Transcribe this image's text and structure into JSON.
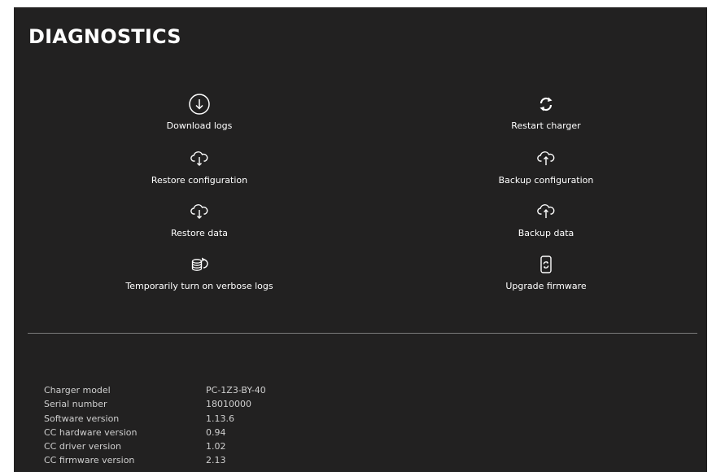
{
  "page": {
    "title": "DIAGNOSTICS"
  },
  "actions": {
    "download_logs": {
      "label": "Download logs",
      "icon": "download-circle-icon"
    },
    "restart_charger": {
      "label": "Restart charger",
      "icon": "refresh-icon"
    },
    "restore_configuration": {
      "label": "Restore configuration",
      "icon": "cloud-download-icon"
    },
    "backup_configuration": {
      "label": "Backup configuration",
      "icon": "cloud-upload-icon"
    },
    "restore_data": {
      "label": "Restore data",
      "icon": "cloud-download-icon"
    },
    "backup_data": {
      "label": "Backup data",
      "icon": "cloud-upload-icon"
    },
    "verbose_logs": {
      "label": "Temporarily turn on verbose logs",
      "icon": "database-refresh-icon"
    },
    "upgrade_firmware": {
      "label": "Upgrade firmware",
      "icon": "device-refresh-icon"
    }
  },
  "info": [
    {
      "key": "Charger model",
      "value": "PC-1Z3-BY-40"
    },
    {
      "key": "Serial number",
      "value": "18010000"
    },
    {
      "key": "Software version",
      "value": "1.13.6"
    },
    {
      "key": "CC hardware version",
      "value": "0.94"
    },
    {
      "key": "CC driver version",
      "value": "1.02"
    },
    {
      "key": "CC firmware version",
      "value": "2.13"
    }
  ],
  "colors": {
    "panel_background": "#222121",
    "text": "#ffffff",
    "info_text": "#cfcfcf",
    "divider": "#7a7a7a"
  }
}
